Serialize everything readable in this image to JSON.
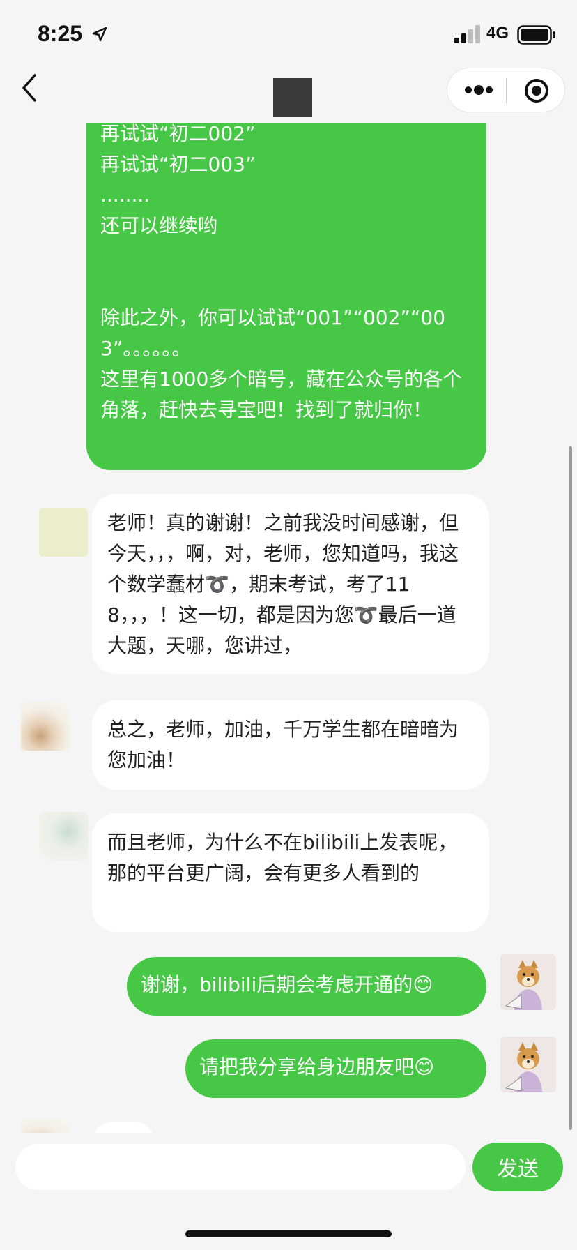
{
  "status_bar": {
    "time": "8:25",
    "network": "4G"
  },
  "nav": {
    "back_icon": "chevron-left-icon",
    "more_icon": "more-dots-icon",
    "close_icon": "target-circle-icon"
  },
  "messages": [
    {
      "side": "right",
      "color": "#46c746",
      "text": "再试试“初二002”\n再试试“初二003”\n........\n还可以继续哟\n\n\n除此之外，你可以试试“001”“002”“003”。。。。。。\n这里有1000多个暗号，藏在公众号的各个角落，赶快去寻宝吧！找到了就归你！"
    },
    {
      "side": "left",
      "text": "老师！真的谢谢！之前我没时间感谢，但今天，，，啊，对，老师，您知道吗，我这个数学蠢材➰，期末考试，考了118，，，！这一切，都是因为您➰最后一道大题，天哪，您讲过，"
    },
    {
      "side": "left",
      "text": "总之，老师，加油，千万学生都在暗暗为您加油！"
    },
    {
      "side": "left",
      "text": "而且老师，为什么不在bilibili上发表呢，那的平台更广阔，会有更多人看到的"
    },
    {
      "side": "right",
      "text": "谢谢，bilibili后期会考虑开通的😊"
    },
    {
      "side": "right",
      "text": "请把我分享给身边朋友吧😊"
    }
  ],
  "composer": {
    "placeholder": "",
    "send_label": "发送"
  },
  "colors": {
    "bubble_green": "#46c746",
    "background": "#f5f5f5"
  }
}
